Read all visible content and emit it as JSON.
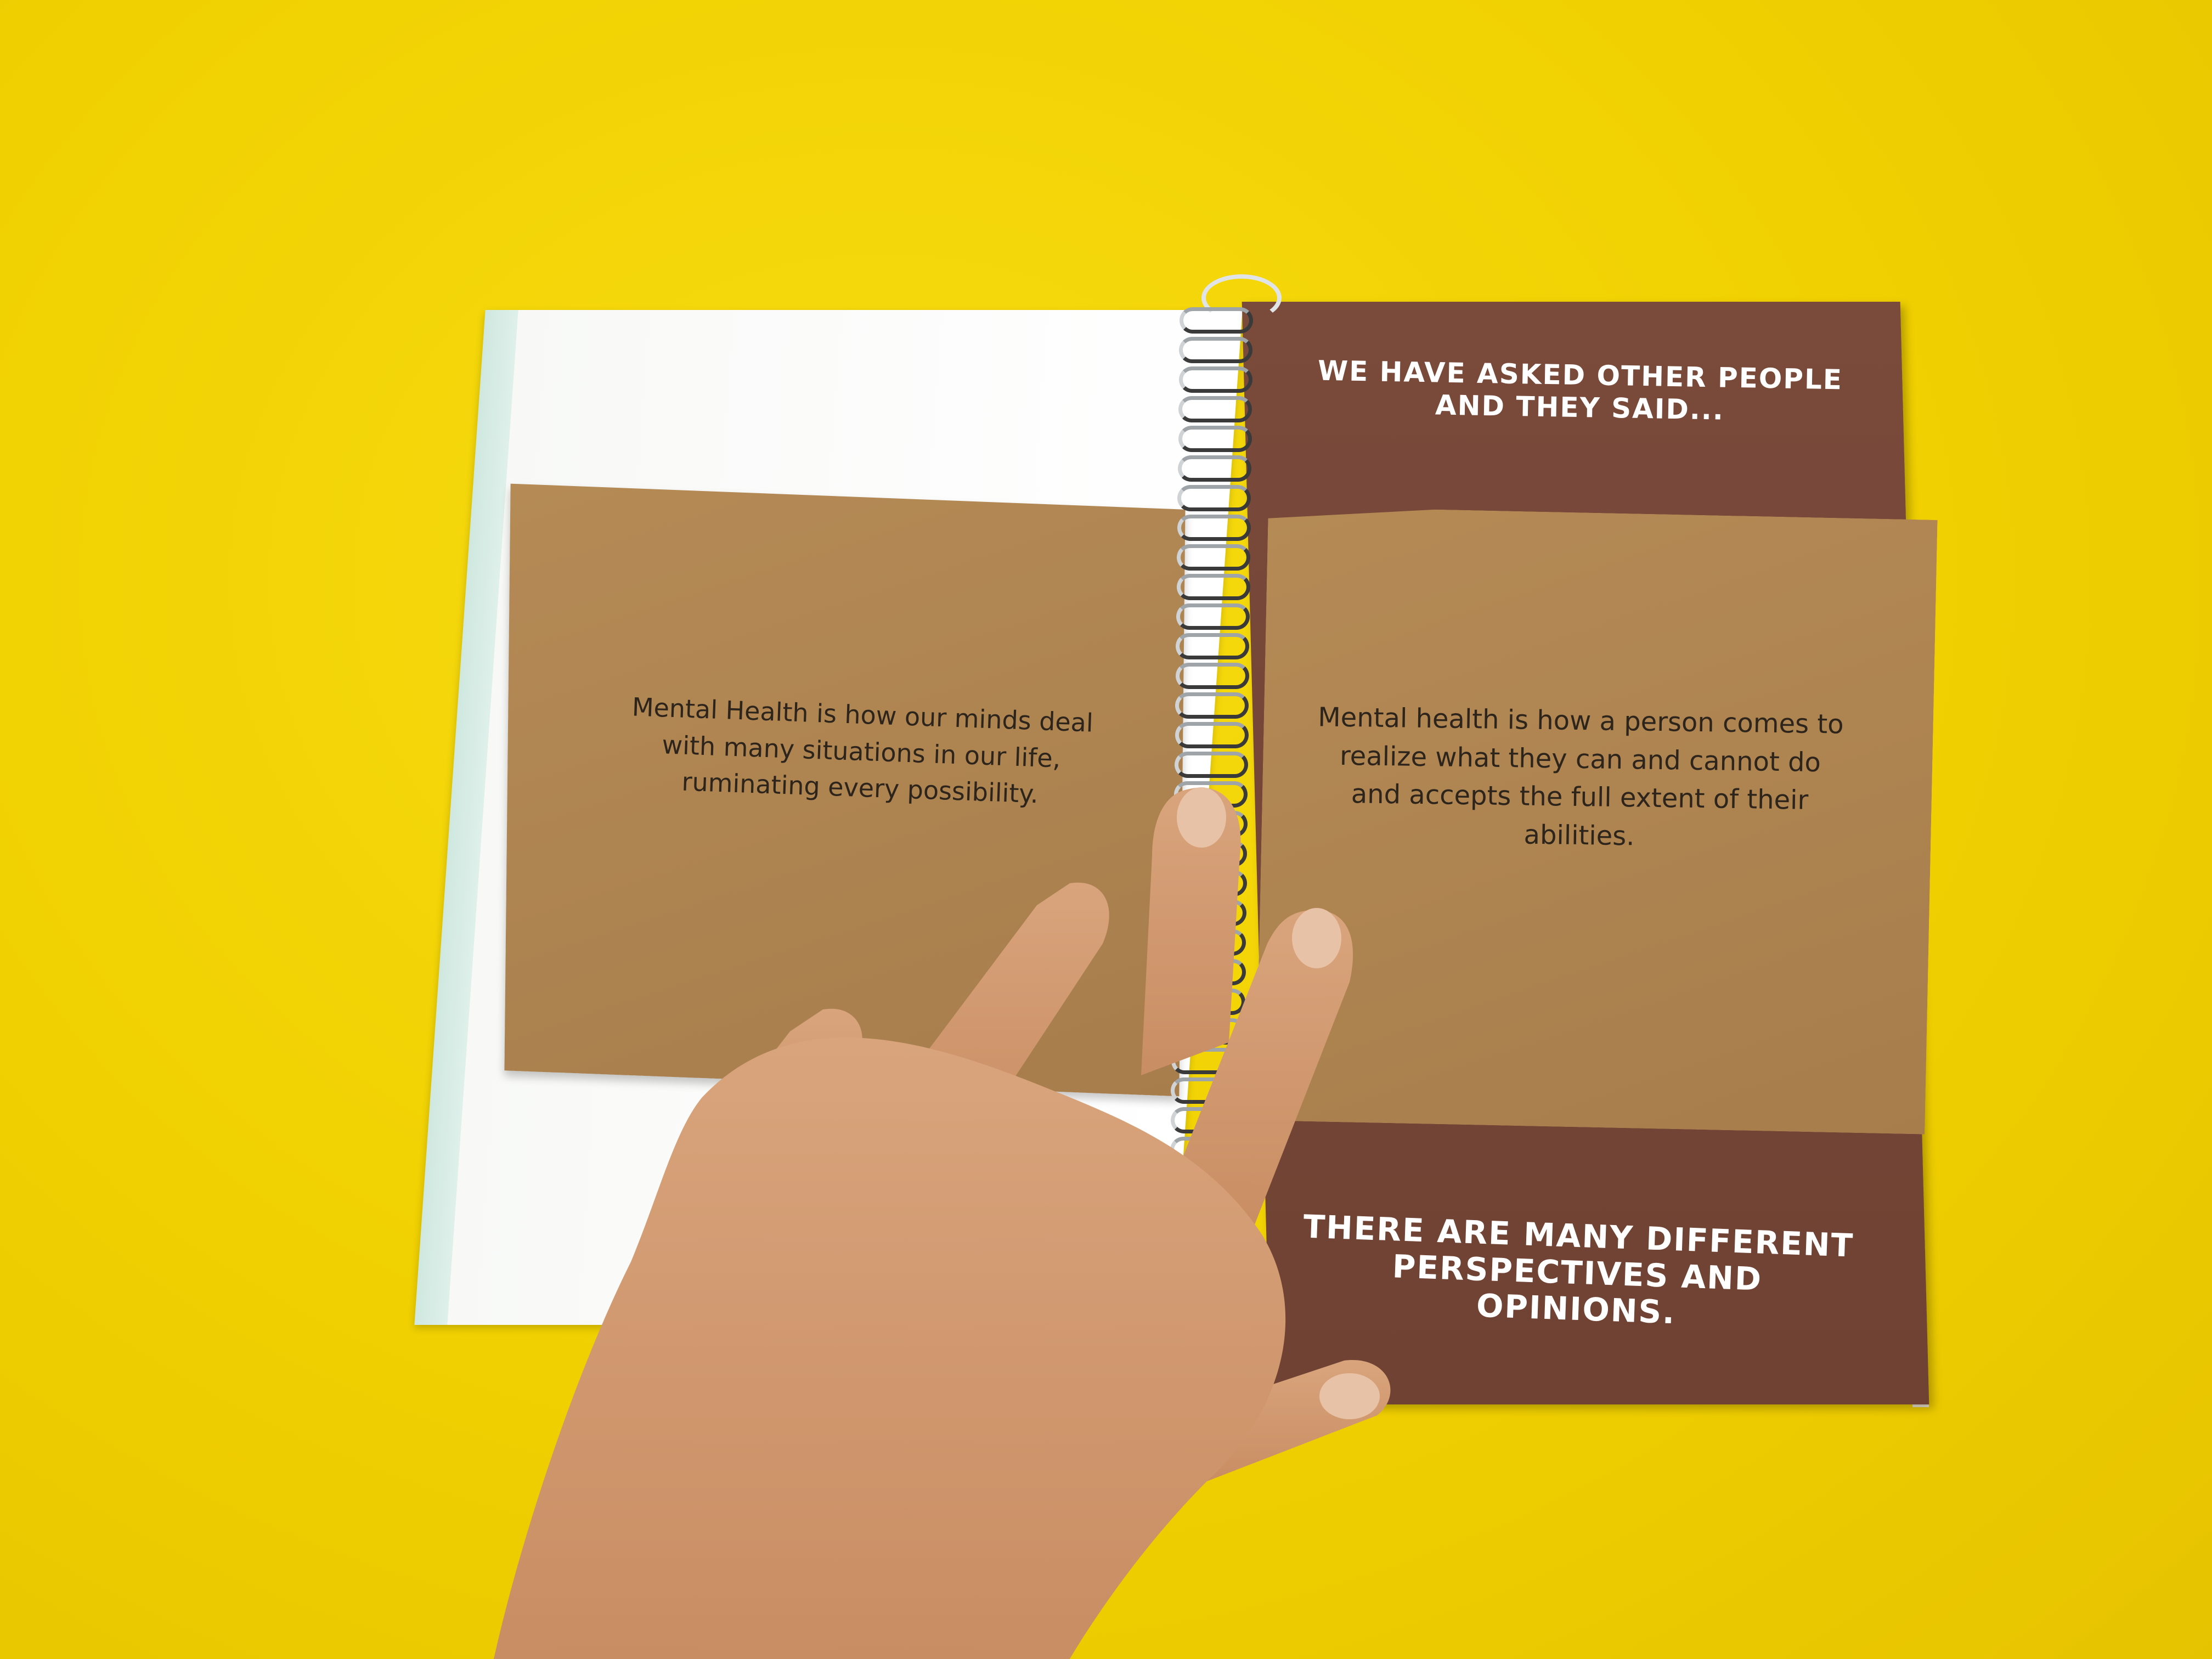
{
  "scene": {
    "background_color": "#f0d000",
    "brown_page_color": "#74463a",
    "kraft_color": "#b08652"
  },
  "booklet": {
    "right_page": {
      "top_headline": "WE HAVE ASKED OTHER PEOPLE AND THEY SAID...",
      "bottom_headline": "THERE ARE MANY DIFFERENT PERSPECTIVES AND OPINIONS."
    },
    "card": {
      "left_quote": "Mental Health is how our minds deal with many situations in our life, ruminating every possibility.",
      "right_quote": "Mental health is how a person comes to realize what they can and cannot do and accepts the full extent of their abilities."
    }
  }
}
